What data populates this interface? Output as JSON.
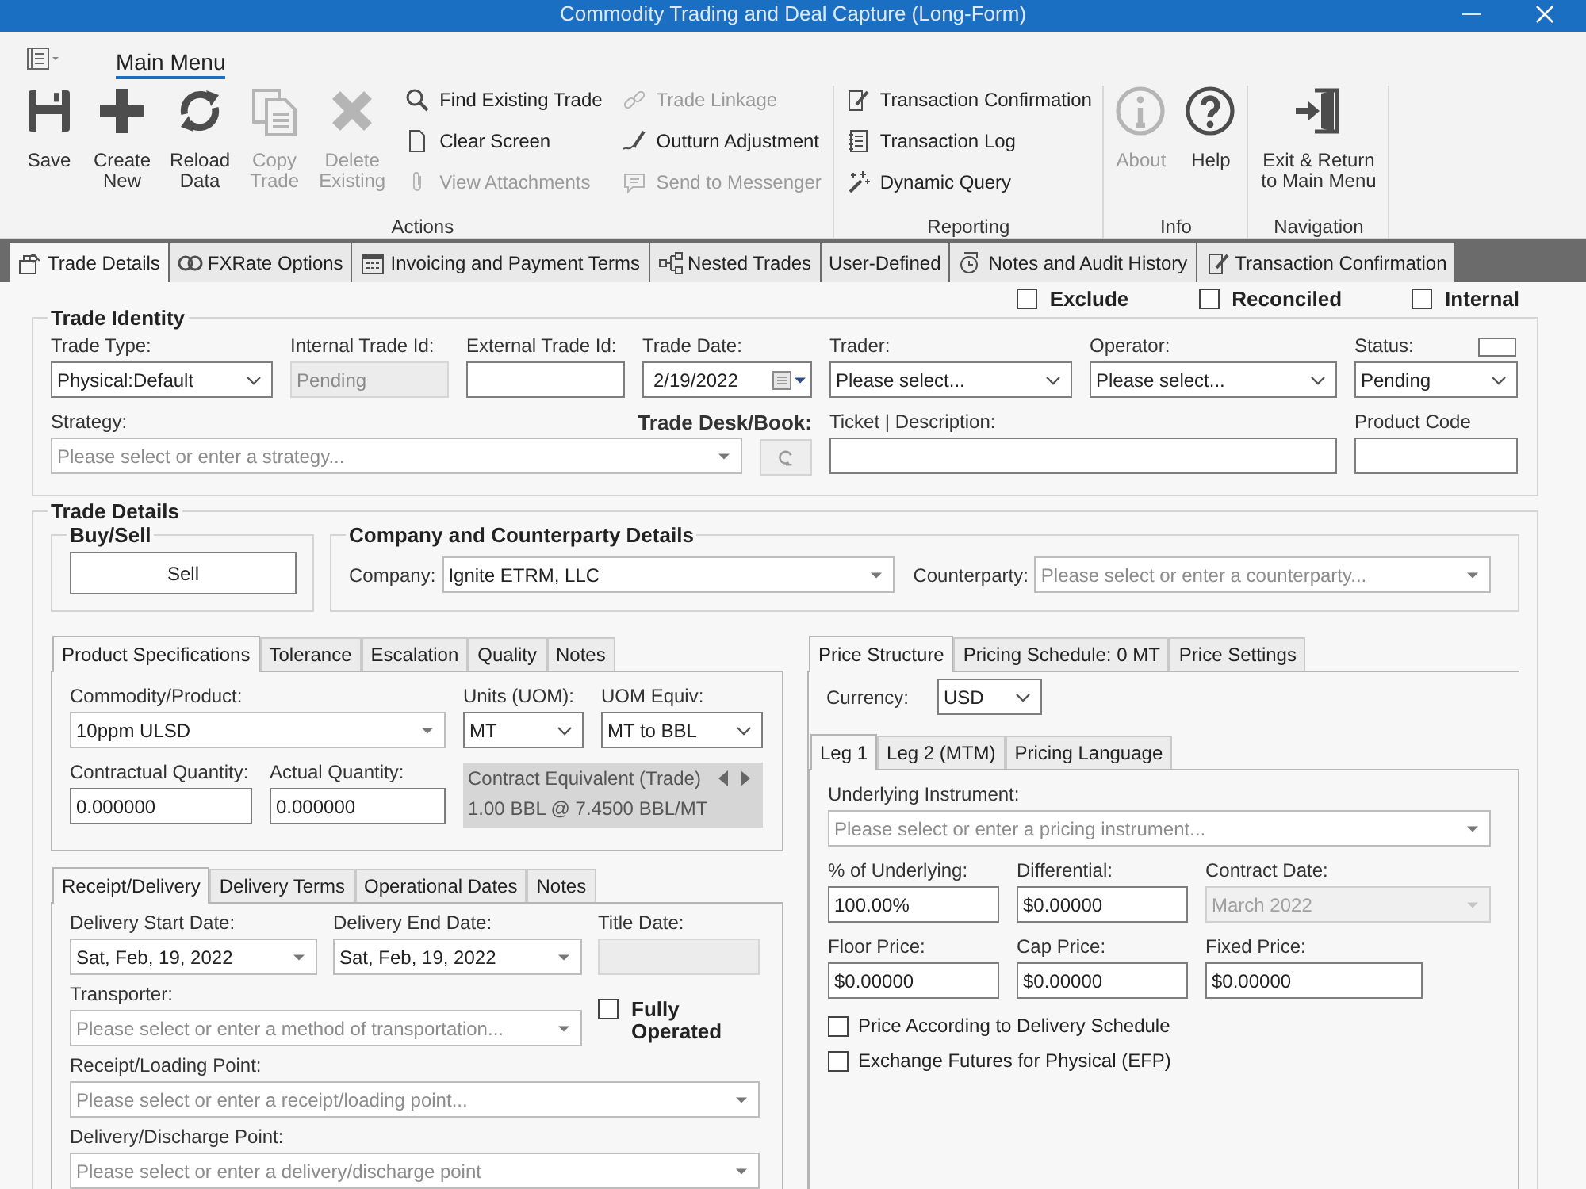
{
  "window": {
    "title": "Commodity Trading and Deal Capture (Long-Form)"
  },
  "ribbon": {
    "menu_tab": "Main Menu",
    "groups": [
      {
        "label": "Actions",
        "large": [
          {
            "label": "Save",
            "disabled": false
          },
          {
            "label": "Create New",
            "disabled": false
          },
          {
            "label": "Reload Data",
            "disabled": false
          },
          {
            "label": "Copy Trade",
            "disabled": true
          },
          {
            "label": "Delete Existing",
            "disabled": true
          }
        ],
        "columns": [
          [
            {
              "label": "Find Existing Trade",
              "disabled": false
            },
            {
              "label": "Clear Screen",
              "disabled": false
            },
            {
              "label": "View Attachments",
              "disabled": true
            }
          ],
          [
            {
              "label": "Trade Linkage",
              "disabled": true
            },
            {
              "label": "Outturn Adjustment",
              "disabled": false
            },
            {
              "label": "Send to Messenger",
              "disabled": true
            }
          ]
        ]
      },
      {
        "label": "Reporting",
        "columns": [
          [
            {
              "label": "Transaction Confirmation",
              "disabled": false
            },
            {
              "label": "Transaction Log",
              "disabled": false
            },
            {
              "label": "Dynamic Query",
              "disabled": false
            }
          ]
        ]
      },
      {
        "label": "Info",
        "large": [
          {
            "label": "About",
            "disabled": true
          },
          {
            "label": "Help",
            "disabled": false
          }
        ]
      },
      {
        "label": "Navigation",
        "large": [
          {
            "label": "Exit & Return to Main Menu",
            "disabled": false
          }
        ]
      }
    ]
  },
  "tabs": [
    {
      "label": "Trade Details",
      "selected": true
    },
    {
      "label": "FXRate Options",
      "selected": false
    },
    {
      "label": "Invoicing and Payment Terms",
      "selected": false
    },
    {
      "label": "Nested Trades",
      "selected": false
    },
    {
      "label": "User-Defined",
      "selected": false
    },
    {
      "label": "Notes and Audit History",
      "selected": false
    },
    {
      "label": "Transaction Confirmation",
      "selected": false
    }
  ],
  "flags": [
    {
      "label": "Exclude",
      "checked": false
    },
    {
      "label": "Reconciled",
      "checked": false
    },
    {
      "label": "Internal",
      "checked": false
    }
  ],
  "trade_identity": {
    "title": "Trade Identity",
    "fields": [
      {
        "label": "Trade Type:",
        "kind": "dropdown",
        "value": "Physical:Default"
      },
      {
        "label": "Internal Trade Id:",
        "kind": "readonly",
        "value": "Pending"
      },
      {
        "label": "External Trade Id:",
        "kind": "text"
      },
      {
        "label": "Trade Date:",
        "kind": "date",
        "value": "2/19/2022"
      },
      {
        "label": "Trader:",
        "kind": "dropdown",
        "value": "Please select..."
      },
      {
        "label": "Operator:",
        "kind": "dropdown",
        "value": "Please select..."
      },
      {
        "label": "Status:",
        "kind": "swatch_dropdown",
        "value": "Pending"
      },
      {
        "label": "Strategy:",
        "kind": "combo",
        "placeholder": "Please select or enter a strategy...",
        "disabled": false
      },
      {
        "label": "Trade Desk/Book:",
        "kind": "lookup"
      },
      {
        "label": "Ticket | Description:",
        "kind": "text"
      },
      {
        "label": "Product Code",
        "kind": "text"
      }
    ]
  },
  "trade_details": {
    "title": "Trade Details",
    "buy_sell": {
      "title": "Buy/Sell",
      "button": "Sell"
    },
    "company": {
      "title": "Company and Counterparty Details",
      "fields": [
        {
          "label": "Company:",
          "kind": "combo",
          "value": "Ignite ETRM, LLC",
          "disabled": false
        },
        {
          "label": "Counterparty:",
          "kind": "combo",
          "placeholder": "Please select or enter a counterparty...",
          "disabled": false
        }
      ]
    },
    "product_tabs": [
      {
        "label": "Product Specifications",
        "selected": true
      },
      {
        "label": "Tolerance",
        "selected": false
      },
      {
        "label": "Escalation",
        "selected": false
      },
      {
        "label": "Quality",
        "selected": false
      },
      {
        "label": "Notes",
        "selected": false
      }
    ],
    "product_fields": [
      {
        "label": "Commodity/Product:",
        "kind": "combo",
        "value": "10ppm ULSD",
        "disabled": false
      },
      {
        "label": "Units (UOM):",
        "kind": "dropdown",
        "value": "MT"
      },
      {
        "label": "UOM Equiv:",
        "kind": "dropdown",
        "value": "MT to BBL"
      },
      {
        "label": "Contractual Quantity:",
        "kind": "text",
        "value": "0.000000"
      },
      {
        "label": "Actual Quantity:",
        "kind": "text",
        "value": "0.000000"
      }
    ],
    "contract_equivalent": {
      "title": "Contract Equivalent (Trade)",
      "value": "1.00 BBL @ 7.4500 BBL/MT"
    },
    "delivery_tabs": [
      {
        "label": "Receipt/Delivery",
        "selected": true
      },
      {
        "label": "Delivery Terms",
        "selected": false
      },
      {
        "label": "Operational Dates",
        "selected": false
      },
      {
        "label": "Notes",
        "selected": false
      }
    ],
    "delivery_fields": [
      {
        "label": "Delivery Start Date:",
        "kind": "combo",
        "value": "Sat, Feb, 19, 2022",
        "disabled": false
      },
      {
        "label": "Delivery End Date:",
        "kind": "combo",
        "value": "Sat, Feb, 19, 2022",
        "disabled": false
      },
      {
        "label": "Title Date:",
        "kind": "readonly"
      },
      {
        "label": "Transporter:",
        "kind": "combo",
        "placeholder": "Please select or enter a method of transportation...",
        "disabled": false
      },
      {
        "label": "Fully Operated",
        "kind": "checkbox",
        "checked": false
      },
      {
        "label": "Receipt/Loading Point:",
        "kind": "combo",
        "placeholder": "Please select or enter a receipt/loading point...",
        "disabled": false
      },
      {
        "label": "Delivery/Discharge Point:",
        "kind": "combo",
        "placeholder": "Please select or enter a delivery/discharge point",
        "disabled": false
      }
    ],
    "price_tabs": [
      {
        "label": "Price Structure",
        "selected": true
      },
      {
        "label": "Pricing Schedule: 0 MT",
        "selected": false
      },
      {
        "label": "Price Settings",
        "selected": false
      }
    ],
    "currency": {
      "label": "Currency:",
      "kind": "dropdown",
      "value": "USD"
    },
    "leg_tabs": [
      {
        "label": "Leg 1",
        "selected": true
      },
      {
        "label": "Leg 2 (MTM)",
        "selected": false
      },
      {
        "label": "Pricing Language",
        "selected": false
      }
    ],
    "price_fields": [
      {
        "label": "Underlying Instrument:",
        "kind": "combo",
        "placeholder": "Please select or enter a pricing instrument...",
        "disabled": false
      },
      {
        "label": "% of Underlying:",
        "kind": "text",
        "value": "100.00%"
      },
      {
        "label": "Differential:",
        "kind": "text",
        "value": "$0.00000"
      },
      {
        "label": "Contract Date:",
        "kind": "combo",
        "value": "March 2022",
        "disabled": true
      },
      {
        "label": "Floor Price:",
        "kind": "text",
        "value": "$0.00000"
      },
      {
        "label": "Cap Price:",
        "kind": "text",
        "value": "$0.00000"
      },
      {
        "label": "Fixed Price:",
        "kind": "text",
        "value": "$0.00000"
      },
      {
        "label": "Price According to Delivery Schedule",
        "kind": "checkbox",
        "checked": false
      },
      {
        "label": "Exchange Futures for Physical (EFP)",
        "kind": "checkbox",
        "checked": false
      }
    ]
  }
}
